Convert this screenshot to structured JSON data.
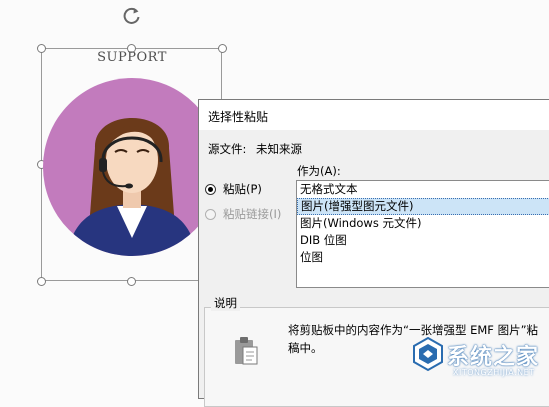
{
  "canvas": {
    "support_text": "SUPPORT",
    "shape_colors": {
      "circle": "#c27bbd",
      "hair": "#6b3a1a",
      "skin": "#f7d9c0",
      "suit": "#27357f",
      "shirt": "#ffffff"
    }
  },
  "dialog": {
    "title": "选择性粘贴",
    "source_label": "源文件:",
    "source_value": "未知来源",
    "as_label": "作为(A):",
    "options": [
      {
        "label": "粘贴(P)",
        "checked": true,
        "enabled": true
      },
      {
        "label": "粘贴链接(I)",
        "checked": false,
        "enabled": false
      }
    ],
    "formats": [
      "无格式文本",
      "图片(增强型图元文件)",
      "图片(Windows 元文件)",
      "DIB 位图",
      "位图"
    ],
    "selected_format": "图片(增强型图元文件)",
    "description_label": "说明",
    "description_line1": "将剪贴板中的内容作为“一张增强型 EMF 图片”粘",
    "description_line2": "稿中。",
    "icons": {
      "clipboard": "clipboard-icon"
    }
  },
  "watermark": {
    "text_cn": "系统之家",
    "text_en": "XITONGZHIJIA.NET",
    "color": "#2a6cb0"
  }
}
